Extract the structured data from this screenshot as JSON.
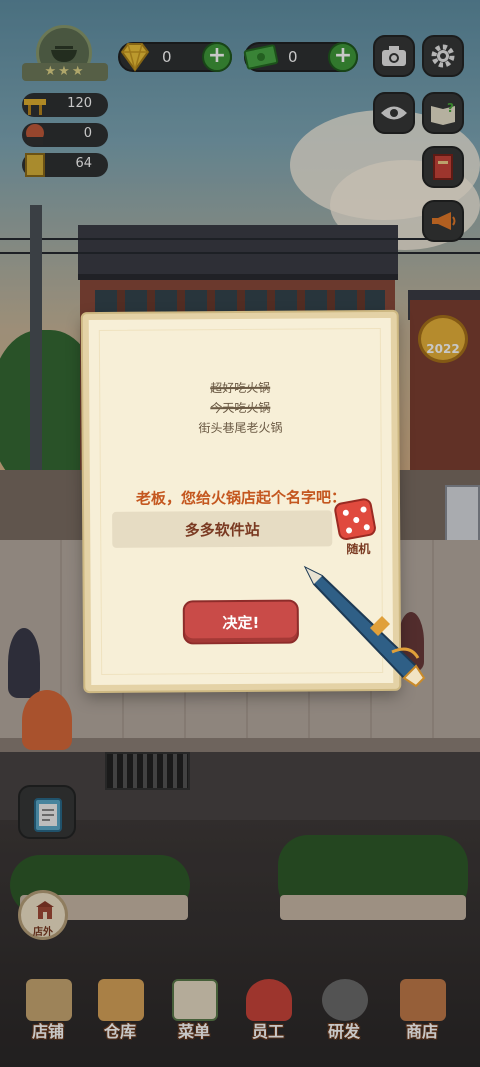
{
  "hud": {
    "badge_icon": "hotpot-badge-icon",
    "badge_stars": "★★★",
    "gems": {
      "value": "0",
      "icon": "diamond-icon",
      "add": "+"
    },
    "cash": {
      "value": "0",
      "icon": "banknote-icon",
      "add": "+"
    },
    "stats": [
      {
        "icon": "table-icon",
        "value": "120"
      },
      {
        "icon": "chef-icon",
        "value": "0"
      },
      {
        "icon": "book-icon",
        "value": "64"
      }
    ],
    "buttons": [
      "camera-icon",
      "settings-icon",
      "eye-icon",
      "guide-book-icon",
      "recipe-book-icon",
      "megaphone-icon"
    ],
    "year_badge": "2022"
  },
  "dialog": {
    "old_names": [
      "超好吃火锅",
      "今天吃火锅",
      "街头巷尾老火锅"
    ],
    "prompt": "老板，您给火锅店起个名字吧：",
    "name_value": "多多软件站",
    "random_label": "随机",
    "confirm_label": "决定!"
  },
  "side": {
    "shop_out_label": "店外"
  },
  "nav": {
    "items": [
      {
        "label": "店铺",
        "icon": "storefront-icon",
        "color": "#c9a873"
      },
      {
        "label": "仓库",
        "icon": "crate-icon",
        "color": "#d9a55a"
      },
      {
        "label": "菜单",
        "icon": "menu-clipboard-icon",
        "color": "#e7dcc5"
      },
      {
        "label": "员工",
        "icon": "staff-icon",
        "color": "#c9453a"
      },
      {
        "label": "研发",
        "icon": "cooking-pot-icon",
        "color": "#6b6b6b"
      },
      {
        "label": "商店",
        "icon": "shop-stall-icon",
        "color": "#c07a4a"
      }
    ]
  },
  "colors": {
    "accent_orange": "#c4571f",
    "confirm_red": "#c94b48",
    "plus_green": "#3f9a3a",
    "paper": "#f7efd7"
  }
}
